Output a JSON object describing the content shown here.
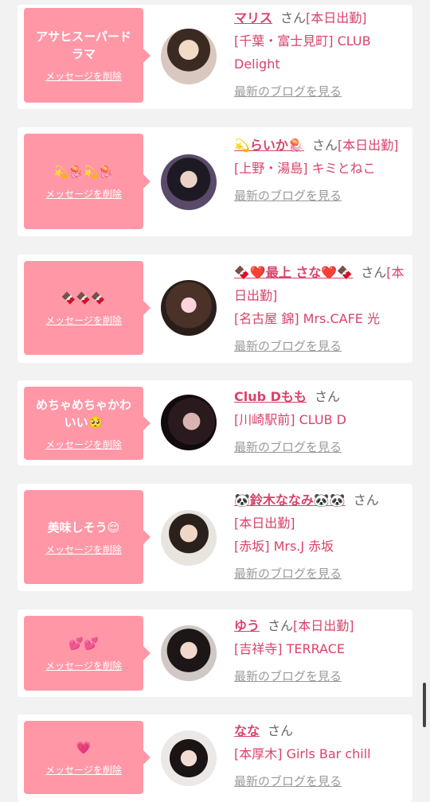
{
  "delete_label": "メッセージを削除",
  "san": "さん",
  "blog_label": "最新のブログを見る",
  "colors": {
    "bubble": "#ff97a7",
    "name": "#d8436a",
    "muted": "#9a9a9a",
    "bg": "#f2f2f2"
  },
  "cards": [
    {
      "message": "アサヒスーパードラマ",
      "name": "マリス",
      "status": "[本日出勤]",
      "shop": "[千葉・富士見町] CLUB Delight"
    },
    {
      "message": "💫🪼💫🪼",
      "name": "💫らいか🪼",
      "status": "[本日出勤]",
      "shop": "[上野・湯島] キミとねこ"
    },
    {
      "message": "🍫🍫🍫",
      "name": "🍫❤️最上 さな❤️🍫",
      "status": "[本日出勤]",
      "shop": "[名古屋 錦] Mrs.CAFE 光"
    },
    {
      "message": "めちゃめちゃかわいい🥺",
      "name": "Club Dもも",
      "status": "",
      "shop": "[川崎駅前] CLUB D"
    },
    {
      "message": "美味しそう😌",
      "name": "🐼鈴木ななみ🐼🐼",
      "status": "[本日出勤]",
      "shop": "[赤坂] Mrs.J 赤坂"
    },
    {
      "message": "💕💕",
      "name": "ゆう",
      "status": "[本日出勤]",
      "shop": "[吉祥寺] TERRACE"
    },
    {
      "message": "💗",
      "name": "なな",
      "status": "",
      "shop": "[本厚木] Girls Bar chill"
    }
  ]
}
